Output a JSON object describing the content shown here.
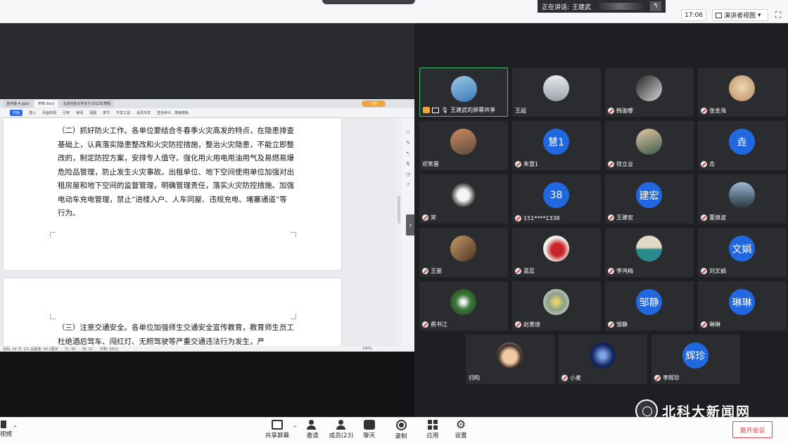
{
  "top_bar": {
    "speaker_prefix": "正在讲话:",
    "speaker_name": "王建武",
    "clock": "17:06",
    "view_label": "演讲者视图"
  },
  "document": {
    "tabs": [
      "宣传委-4.pptx",
      "学校.docx",
      "北京科技大学关于2022年寒假"
    ],
    "ribbon": [
      "开始",
      "插入",
      "页面布局",
      "引用",
      "审阅",
      "视图",
      "章节",
      "开发工具",
      "会员专享",
      "查找命令、搜索模板"
    ],
    "share_label": "分享",
    "paragraph1": "（二）抓好防火工作。各单位要结合冬春季火灾高发的特点，在隐患排查基础上，认真落实隐患整改和火灾防控措施，整治火灾隐患，不能立即整改的，制定防控方案，安排专人值守。强化用火用电用油用气及易燃易爆危险品管理，防止发生火灾事故。出租单位、地下空间使用单位加强对出租房屋和地下空间的监督管理，明确管理责任，落实火灾防控措施。加强电动车充电管理，禁止“进楼入户、人车同屋、违规充电、堵塞通道”等行为。",
    "paragraph2": "（三）注意交通安全。各单位加强师生交通安全宣传教育，教育师生员工杜绝酒后驾车、闯红灯、无照驾驶等严重交通违法行为发生，严",
    "status": [
      "页码: 24 节: 1/1 设置值: 24.1厘米",
      "行: 30",
      "列: 12",
      "字数: 3413"
    ],
    "zoom": "140%"
  },
  "participants": [
    {
      "name": "王建武的屏幕共享",
      "avatar_text": "",
      "muted": false,
      "sharing": true
    },
    {
      "name": "王超",
      "avatar_text": "",
      "muted": false,
      "sharing": false
    },
    {
      "name": "韩珈睿",
      "avatar_text": "",
      "muted": true,
      "sharing": false
    },
    {
      "name": "张金海",
      "avatar_text": "",
      "muted": true,
      "sharing": false
    },
    {
      "name": "邓笑蓉",
      "avatar_text": "",
      "muted": false,
      "sharing": false
    },
    {
      "name": "朱慧1",
      "avatar_text": "慧1",
      "muted": true,
      "sharing": false
    },
    {
      "name": "徐立业",
      "avatar_text": "",
      "muted": true,
      "sharing": false
    },
    {
      "name": "垚",
      "avatar_text": "垚",
      "muted": true,
      "sharing": false
    },
    {
      "name": "宋",
      "avatar_text": "",
      "muted": true,
      "sharing": false
    },
    {
      "name": "151****1338",
      "avatar_text": "38",
      "muted": true,
      "sharing": false
    },
    {
      "name": "王建宏",
      "avatar_text": "建宏",
      "muted": true,
      "sharing": false
    },
    {
      "name": "董焕波",
      "avatar_text": "",
      "muted": true,
      "sharing": false
    },
    {
      "name": "王丽",
      "avatar_text": "",
      "muted": true,
      "sharing": false
    },
    {
      "name": "蓝蕊",
      "avatar_text": "",
      "muted": true,
      "sharing": false
    },
    {
      "name": "李鸿梅",
      "avatar_text": "",
      "muted": true,
      "sharing": false
    },
    {
      "name": "刘文娟",
      "avatar_text": "文娟",
      "muted": true,
      "sharing": false
    },
    {
      "name": "费书江",
      "avatar_text": "",
      "muted": true,
      "sharing": false
    },
    {
      "name": "赵普迪",
      "avatar_text": "",
      "muted": true,
      "sharing": false
    },
    {
      "name": "邹静",
      "avatar_text": "邹静",
      "muted": true,
      "sharing": false
    },
    {
      "name": "琳琳",
      "avatar_text": "琳琳",
      "muted": true,
      "sharing": false
    },
    {
      "name": "归昀",
      "avatar_text": "",
      "muted": false,
      "sharing": false
    },
    {
      "name": "小麦",
      "avatar_text": "",
      "muted": true,
      "sharing": false
    },
    {
      "name": "李辉珍",
      "avatar_text": "辉珍",
      "muted": true,
      "sharing": false
    }
  ],
  "watermark": "北科大新闻网",
  "toolbar": {
    "video_label": "视频",
    "share_label": "共享屏幕",
    "invite_label": "邀请",
    "members_label": "成员(23)",
    "chat_label": "聊天",
    "record_label": "录制",
    "apps_label": "应用",
    "settings_label": "设置",
    "leave_label": "离开会议"
  },
  "colors": {
    "accent_blue": "#2168e0",
    "leave_red": "#e04848",
    "active_speaker_green": "#3fbf72",
    "share_orange": "#f2a33a"
  }
}
